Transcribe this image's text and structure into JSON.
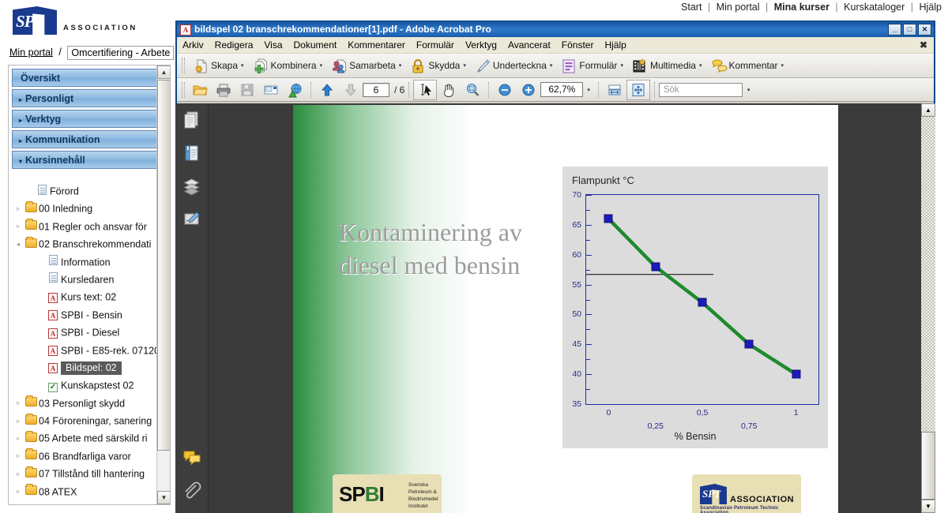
{
  "topnav": {
    "items": [
      {
        "label": "Start",
        "active": false
      },
      {
        "label": "Min portal",
        "active": false
      },
      {
        "label": "Mina kurser",
        "active": true
      },
      {
        "label": "Kurskataloger",
        "active": false
      },
      {
        "label": "Hjälp",
        "active": false
      }
    ],
    "separator": "|"
  },
  "logo": {
    "mark": "SPT",
    "word": "ASSOCIATION"
  },
  "breadcrumb": {
    "root": "Min portal",
    "separator": "/",
    "current": "Omcertifiering - Arbete"
  },
  "sidebar": {
    "accordion": [
      {
        "label": "Översikt",
        "arrow": "",
        "expanded": false
      },
      {
        "label": "Personligt",
        "arrow": "▸",
        "expanded": false
      },
      {
        "label": "Verktyg",
        "arrow": "▸",
        "expanded": false
      },
      {
        "label": "Kommunikation",
        "arrow": "▸",
        "expanded": false
      },
      {
        "label": "Kursinnehåll",
        "arrow": "▾",
        "expanded": true
      }
    ],
    "tree": [
      {
        "label": "Förord",
        "icon": "document-icon",
        "indent": 1,
        "twisty": "",
        "selected": false
      },
      {
        "label": "00 Inledning",
        "icon": "folder-icon",
        "indent": 0,
        "twisty": "▹",
        "selected": false
      },
      {
        "label": "01 Regler och ansvar för",
        "icon": "folder-icon",
        "indent": 0,
        "twisty": "▹",
        "selected": false
      },
      {
        "label": "02 Branschrekommendati",
        "icon": "folder-icon",
        "indent": 0,
        "twisty": "◂",
        "selected": false
      },
      {
        "label": "Information",
        "icon": "document-icon",
        "indent": 2,
        "twisty": "",
        "selected": false
      },
      {
        "label": "Kursledaren",
        "icon": "document-icon",
        "indent": 2,
        "twisty": "",
        "selected": false
      },
      {
        "label": "Kurs text: 02",
        "icon": "pdf-icon",
        "indent": 2,
        "twisty": "",
        "selected": false
      },
      {
        "label": "SPBI - Bensin",
        "icon": "pdf-icon",
        "indent": 2,
        "twisty": "",
        "selected": false
      },
      {
        "label": "SPBI - Diesel",
        "icon": "pdf-icon",
        "indent": 2,
        "twisty": "",
        "selected": false
      },
      {
        "label": "SPBI - E85-rek. 07120",
        "icon": "pdf-icon",
        "indent": 2,
        "twisty": "",
        "selected": false
      },
      {
        "label": "Bildspel: 02",
        "icon": "pdf-icon",
        "indent": 2,
        "twisty": "",
        "selected": true
      },
      {
        "label": "Kunskapstest 02",
        "icon": "quiz-icon",
        "indent": 2,
        "twisty": "",
        "selected": false
      },
      {
        "label": "03 Personligt skydd",
        "icon": "folder-icon",
        "indent": 0,
        "twisty": "▹",
        "selected": false
      },
      {
        "label": "04 Föroreningar, sanering",
        "icon": "folder-icon",
        "indent": 0,
        "twisty": "▹",
        "selected": false
      },
      {
        "label": "05 Arbete med särskild ri",
        "icon": "folder-icon",
        "indent": 0,
        "twisty": "▹",
        "selected": false
      },
      {
        "label": "06 Brandfarliga varor",
        "icon": "folder-icon",
        "indent": 0,
        "twisty": "▹",
        "selected": false
      },
      {
        "label": "07 Tillstånd till hantering",
        "icon": "folder-icon",
        "indent": 0,
        "twisty": "▹",
        "selected": false
      },
      {
        "label": "08 ATEX",
        "icon": "folder-icon",
        "indent": 0,
        "twisty": "▹",
        "selected": false
      }
    ],
    "scroll_up": "▲",
    "scroll_down": "▼"
  },
  "acrobat": {
    "title": "bildspel 02 branschrekommendationer[1].pdf - Adobe Acrobat Pro",
    "window_buttons": {
      "minimize": "_",
      "restore": "□",
      "close": "✕"
    },
    "menus": [
      "Arkiv",
      "Redigera",
      "Visa",
      "Dokument",
      "Kommentarer",
      "Formulär",
      "Verktyg",
      "Avancerat",
      "Fönster",
      "Hjälp"
    ],
    "doc_close": "✖",
    "toolbar_main": [
      {
        "label": "Skapa",
        "icon": "create-pdf-icon",
        "caret": "▾"
      },
      {
        "label": "Kombinera",
        "icon": "combine-icon",
        "caret": "▾"
      },
      {
        "label": "Samarbeta",
        "icon": "collaborate-icon",
        "caret": "▾"
      },
      {
        "label": "Skydda",
        "icon": "lock-icon",
        "caret": "▾"
      },
      {
        "label": "Underteckna",
        "icon": "pen-icon",
        "caret": "▾"
      },
      {
        "label": "Formulär",
        "icon": "form-icon",
        "caret": "▾"
      },
      {
        "label": "Multimedia",
        "icon": "multimedia-icon",
        "caret": "▾"
      },
      {
        "label": "Kommentar",
        "icon": "comment-icon",
        "caret": "▾"
      }
    ],
    "toolbar_nav": {
      "open_icon": "open-folder-icon",
      "print_icon": "print-icon",
      "save_icon": "save-icon",
      "email_icon": "email-icon",
      "web_icon": "publish-web-icon",
      "prev_icon": "arrow-up-icon",
      "next_icon": "arrow-down-icon",
      "page_current": "6",
      "page_total": "/ 6",
      "select_icon": "select-tool-icon",
      "hand_icon": "hand-tool-icon",
      "marquee_zoom_icon": "marquee-zoom-icon",
      "zoom_out_icon": "zoom-out-icon",
      "zoom_in_icon": "zoom-in-icon",
      "zoom_value": "62,7%",
      "zoom_caret": "▾",
      "fit_width_icon": "fit-width-icon",
      "fit_page_icon": "fit-page-icon",
      "search_placeholder": "Sök",
      "search_value": "",
      "search_caret": "▾"
    },
    "navpane_icons": [
      "pages-icon",
      "bookmarks-icon",
      "layers-icon",
      "signatures-icon",
      "comments-icon",
      "attachments-icon"
    ],
    "scroll_up": "▲",
    "scroll_down": "▼"
  },
  "pdf": {
    "title_line1": "Kontaminering av",
    "title_line2": "diesel med bensin",
    "logo_spbi": {
      "text": "SPBI",
      "lines": [
        "Svenska",
        "Petroleum &",
        "Biodrivmedel",
        "Institutet"
      ]
    },
    "logo_spt": {
      "mark": "SPT",
      "word": "ASSOCIATION",
      "sub": "Scandinavian Petroleum Technic Association"
    }
  },
  "chart_data": {
    "type": "line",
    "title": "Flampunkt °C",
    "xlabel": "% Bensin",
    "ylabel": "",
    "x": [
      0,
      0.25,
      0.5,
      0.75,
      1
    ],
    "values": [
      66,
      58,
      52,
      45,
      40
    ],
    "series": [
      {
        "name": "Flampunkt",
        "values": [
          66,
          58,
          52,
          45,
          40
        ],
        "color": "#1f8a2e",
        "marker_color": "#1b1bbd"
      }
    ],
    "xticks": [
      "0",
      "0,25",
      "0,5",
      "0,75",
      "1"
    ],
    "xtick_values": [
      0,
      0.25,
      0.5,
      0.75,
      1
    ],
    "yticks": [
      "35",
      "40",
      "45",
      "50",
      "55",
      "60",
      "65",
      "70"
    ],
    "ytick_values": [
      35,
      40,
      45,
      50,
      55,
      60,
      65,
      70
    ],
    "ylim": [
      35,
      70
    ],
    "xlim": [
      -0.12,
      1.12
    ],
    "grid": false,
    "legend": "none",
    "reference_line": {
      "y": 56.7,
      "x_from": -0.12,
      "x_to": 0.56,
      "color": "#000000"
    },
    "plot_bg": "#dcdcdc",
    "axis_color": "#1f2fa0",
    "tick_label_color": "#2a2a8c"
  }
}
